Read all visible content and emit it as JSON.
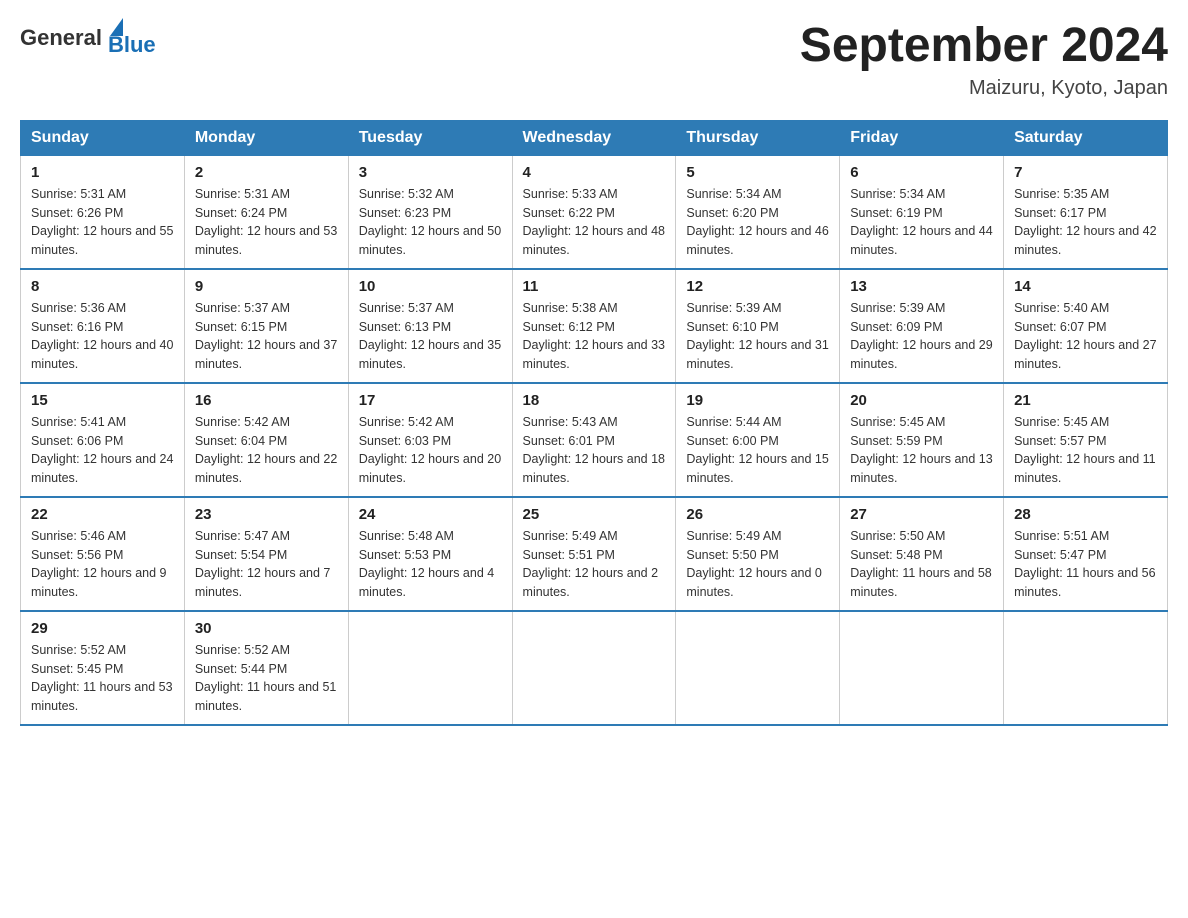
{
  "logo": {
    "general": "General",
    "blue": "Blue"
  },
  "header": {
    "title": "September 2024",
    "location": "Maizuru, Kyoto, Japan"
  },
  "days_of_week": [
    "Sunday",
    "Monday",
    "Tuesday",
    "Wednesday",
    "Thursday",
    "Friday",
    "Saturday"
  ],
  "weeks": [
    [
      {
        "day": "1",
        "sunrise": "5:31 AM",
        "sunset": "6:26 PM",
        "daylight": "12 hours and 55 minutes."
      },
      {
        "day": "2",
        "sunrise": "5:31 AM",
        "sunset": "6:24 PM",
        "daylight": "12 hours and 53 minutes."
      },
      {
        "day": "3",
        "sunrise": "5:32 AM",
        "sunset": "6:23 PM",
        "daylight": "12 hours and 50 minutes."
      },
      {
        "day": "4",
        "sunrise": "5:33 AM",
        "sunset": "6:22 PM",
        "daylight": "12 hours and 48 minutes."
      },
      {
        "day": "5",
        "sunrise": "5:34 AM",
        "sunset": "6:20 PM",
        "daylight": "12 hours and 46 minutes."
      },
      {
        "day": "6",
        "sunrise": "5:34 AM",
        "sunset": "6:19 PM",
        "daylight": "12 hours and 44 minutes."
      },
      {
        "day": "7",
        "sunrise": "5:35 AM",
        "sunset": "6:17 PM",
        "daylight": "12 hours and 42 minutes."
      }
    ],
    [
      {
        "day": "8",
        "sunrise": "5:36 AM",
        "sunset": "6:16 PM",
        "daylight": "12 hours and 40 minutes."
      },
      {
        "day": "9",
        "sunrise": "5:37 AM",
        "sunset": "6:15 PM",
        "daylight": "12 hours and 37 minutes."
      },
      {
        "day": "10",
        "sunrise": "5:37 AM",
        "sunset": "6:13 PM",
        "daylight": "12 hours and 35 minutes."
      },
      {
        "day": "11",
        "sunrise": "5:38 AM",
        "sunset": "6:12 PM",
        "daylight": "12 hours and 33 minutes."
      },
      {
        "day": "12",
        "sunrise": "5:39 AM",
        "sunset": "6:10 PM",
        "daylight": "12 hours and 31 minutes."
      },
      {
        "day": "13",
        "sunrise": "5:39 AM",
        "sunset": "6:09 PM",
        "daylight": "12 hours and 29 minutes."
      },
      {
        "day": "14",
        "sunrise": "5:40 AM",
        "sunset": "6:07 PM",
        "daylight": "12 hours and 27 minutes."
      }
    ],
    [
      {
        "day": "15",
        "sunrise": "5:41 AM",
        "sunset": "6:06 PM",
        "daylight": "12 hours and 24 minutes."
      },
      {
        "day": "16",
        "sunrise": "5:42 AM",
        "sunset": "6:04 PM",
        "daylight": "12 hours and 22 minutes."
      },
      {
        "day": "17",
        "sunrise": "5:42 AM",
        "sunset": "6:03 PM",
        "daylight": "12 hours and 20 minutes."
      },
      {
        "day": "18",
        "sunrise": "5:43 AM",
        "sunset": "6:01 PM",
        "daylight": "12 hours and 18 minutes."
      },
      {
        "day": "19",
        "sunrise": "5:44 AM",
        "sunset": "6:00 PM",
        "daylight": "12 hours and 15 minutes."
      },
      {
        "day": "20",
        "sunrise": "5:45 AM",
        "sunset": "5:59 PM",
        "daylight": "12 hours and 13 minutes."
      },
      {
        "day": "21",
        "sunrise": "5:45 AM",
        "sunset": "5:57 PM",
        "daylight": "12 hours and 11 minutes."
      }
    ],
    [
      {
        "day": "22",
        "sunrise": "5:46 AM",
        "sunset": "5:56 PM",
        "daylight": "12 hours and 9 minutes."
      },
      {
        "day": "23",
        "sunrise": "5:47 AM",
        "sunset": "5:54 PM",
        "daylight": "12 hours and 7 minutes."
      },
      {
        "day": "24",
        "sunrise": "5:48 AM",
        "sunset": "5:53 PM",
        "daylight": "12 hours and 4 minutes."
      },
      {
        "day": "25",
        "sunrise": "5:49 AM",
        "sunset": "5:51 PM",
        "daylight": "12 hours and 2 minutes."
      },
      {
        "day": "26",
        "sunrise": "5:49 AM",
        "sunset": "5:50 PM",
        "daylight": "12 hours and 0 minutes."
      },
      {
        "day": "27",
        "sunrise": "5:50 AM",
        "sunset": "5:48 PM",
        "daylight": "11 hours and 58 minutes."
      },
      {
        "day": "28",
        "sunrise": "5:51 AM",
        "sunset": "5:47 PM",
        "daylight": "11 hours and 56 minutes."
      }
    ],
    [
      {
        "day": "29",
        "sunrise": "5:52 AM",
        "sunset": "5:45 PM",
        "daylight": "11 hours and 53 minutes."
      },
      {
        "day": "30",
        "sunrise": "5:52 AM",
        "sunset": "5:44 PM",
        "daylight": "11 hours and 51 minutes."
      },
      null,
      null,
      null,
      null,
      null
    ]
  ]
}
